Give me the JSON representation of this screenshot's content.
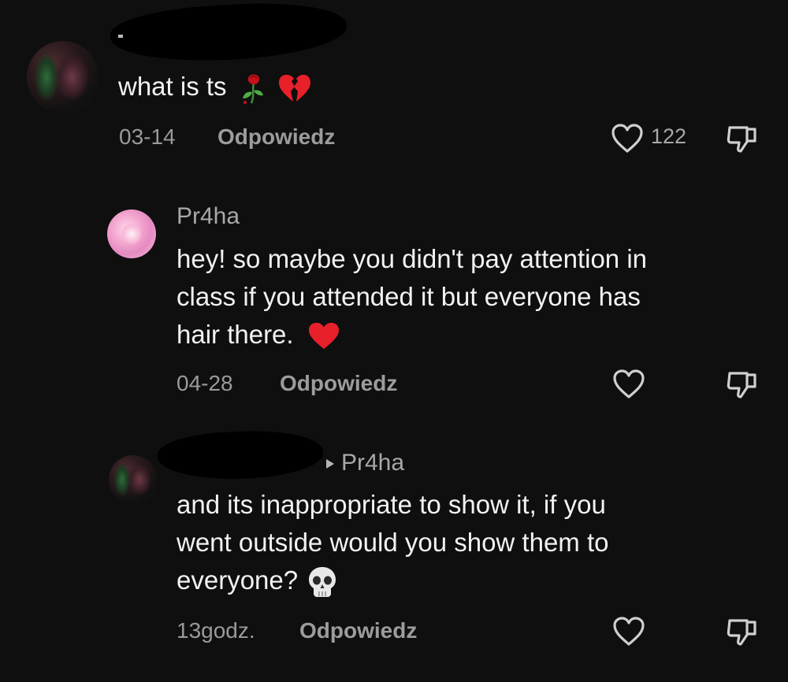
{
  "comments": [
    {
      "text": "what is ts",
      "date": "03-14",
      "reply_label": "Odpowiedz",
      "likes": "122",
      "emojis": [
        "wilted-rose-emoji",
        "broken-heart-emoji"
      ]
    },
    {
      "username": "Pr4ha",
      "text_lines": [
        "hey! so maybe you didn't pay attention in",
        "class if you attended it but everyone has",
        "hair there."
      ],
      "date": "04-28",
      "reply_label": "Odpowiedz",
      "emojis": [
        "red-heart-emoji"
      ]
    },
    {
      "reply_to": "Pr4ha",
      "text_lines": [
        "and its inappropriate to show it, if you",
        "went outside would you show them to",
        "everyone?"
      ],
      "date": "13godz.",
      "reply_label": "Odpowiedz",
      "emojis": [
        "skull-emoji"
      ]
    }
  ],
  "icons": {
    "like": "heart-outline-icon",
    "dislike": "thumbs-down-icon",
    "reply_arrow": "play-arrow-icon"
  },
  "colors": {
    "background": "#0f0f0f",
    "text": "#f2f2f2",
    "muted": "#9a9a9a",
    "heart_red": "#e8202a"
  }
}
